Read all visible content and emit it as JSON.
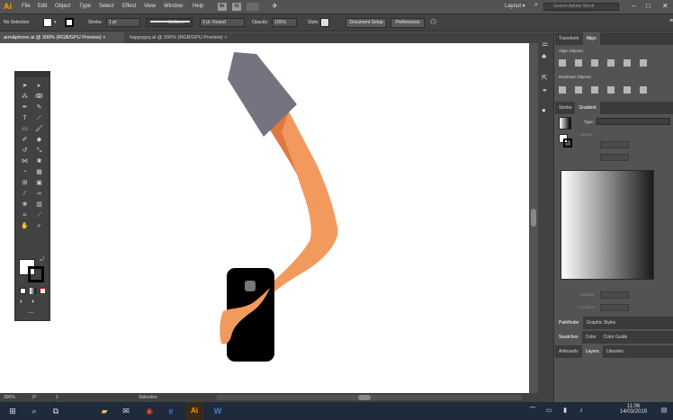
{
  "menubar": {
    "logo": "Ai",
    "items": [
      "File",
      "Edit",
      "Object",
      "Type",
      "Select",
      "Effect",
      "View",
      "Window",
      "Help"
    ],
    "bridge": "Br",
    "stock": "St",
    "layout_label": "Layout",
    "search_placeholder": "Search Adobe Stock"
  },
  "control_bar": {
    "selection_label": "No Selection",
    "stroke_label": "Stroke:",
    "stroke_value": "1 pt",
    "profile_value": "Uniform",
    "brush_value": "3 pt. Round",
    "opacity_label": "Opacity:",
    "opacity_value": "100%",
    "style_label": "Style:",
    "document_setup": "Document Setup",
    "preferences": "Preferences",
    "fill_color": "#ffffff"
  },
  "tabs": [
    {
      "label": "arm&phone.ai @ 300% (RGB/GPU Preview)",
      "active": true
    },
    {
      "label": "happyguy.ai @ 200% (RGB/GPU Preview)",
      "active": false
    }
  ],
  "artwork": {
    "shade_color": "#74737f",
    "sleeve_dark": "#e07840",
    "arm_color": "#f29a5e",
    "phone_color": "#000000",
    "camera_color": "#777777"
  },
  "status": {
    "zoom": "300%",
    "angle": "0°",
    "artboard": "1",
    "tool": "Selection"
  },
  "right_panel": {
    "tabs_top": [
      "Transform",
      "Align"
    ],
    "align_objects": "Align Objects:",
    "distribute_objects": "Distribute Objects:",
    "tabs_mid": [
      "Stroke",
      "Gradient"
    ],
    "type_label": "Type:",
    "stroke_label": "Stroke:",
    "opacity_label": "Opacity:",
    "location_label": "Location:",
    "tabs_a": [
      "Pathfinder",
      "Graphic Styles"
    ],
    "tabs_b": [
      "Swatches",
      "Color",
      "Color Guide"
    ],
    "tabs_c": [
      "Artboards",
      "Layers",
      "Libraries"
    ]
  },
  "taskbar": {
    "time": "11:06",
    "date": "14/03/2019"
  }
}
